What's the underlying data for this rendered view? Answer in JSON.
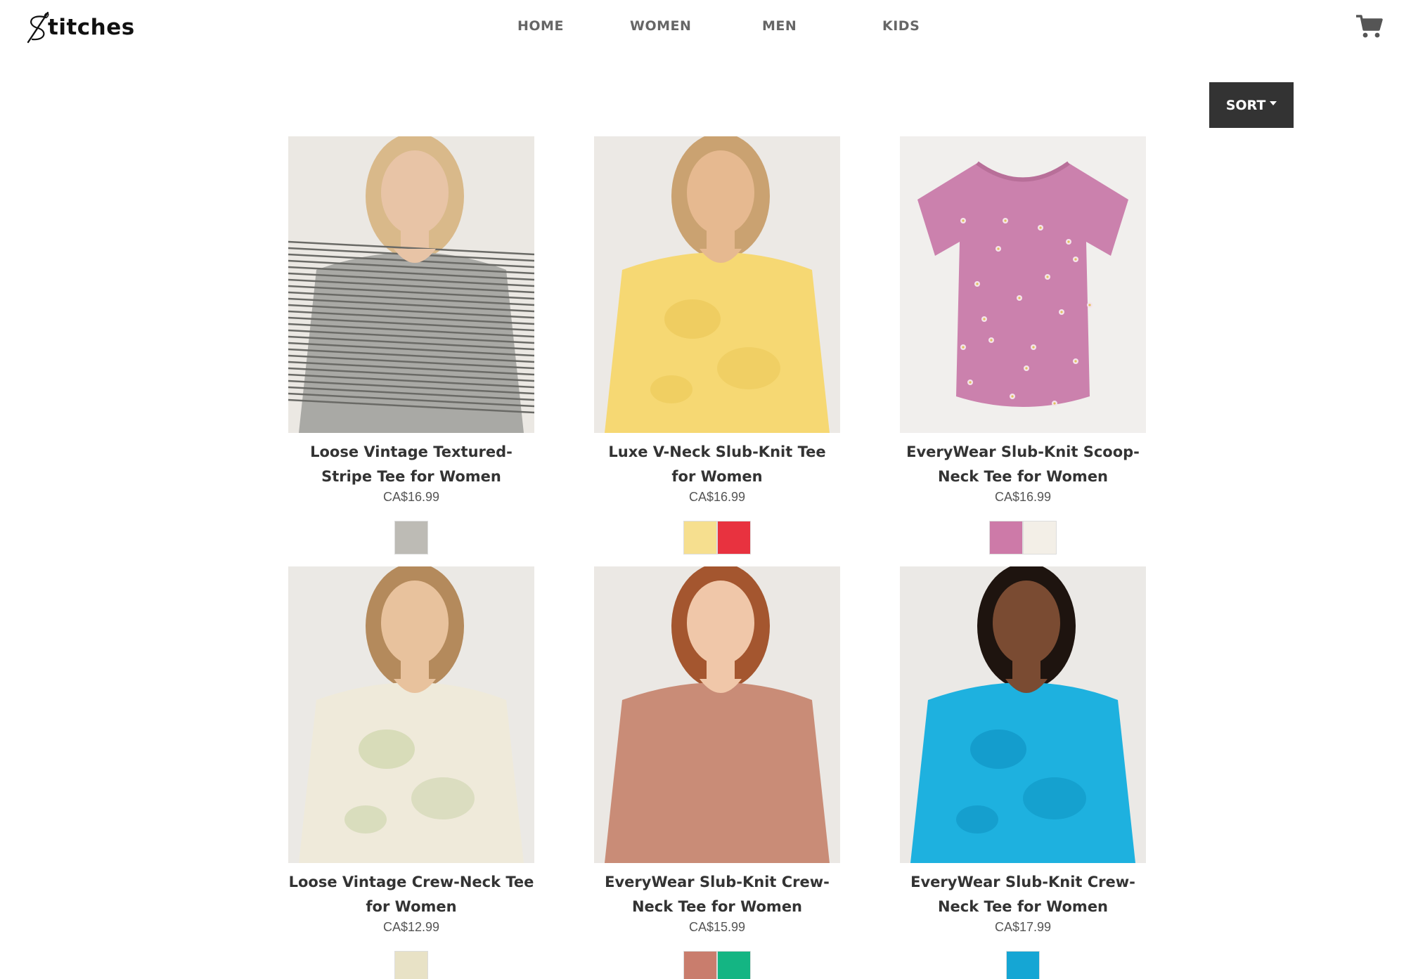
{
  "brand": {
    "name": "titches"
  },
  "nav": {
    "items": [
      "HOME",
      "WOMEN",
      "MEN",
      "KIDS"
    ]
  },
  "sort": {
    "label": "SORT"
  },
  "products": [
    {
      "title": "Loose Vintage Textured-Stripe Tee for Women",
      "price": "CA$16.99",
      "swatches": [
        "#bdbbb5"
      ],
      "image": "woman-striped-gray-tee",
      "colors": {
        "bg": "#ebe8e3",
        "shirt": "#a9a9a5",
        "stripe": "#6a6a66",
        "skin": "#e8c4a6",
        "hair": "#d9b98a"
      }
    },
    {
      "title": "Luxe V-Neck Slub-Knit Tee for Women",
      "price": "CA$16.99",
      "swatches": [
        "#f6df8f",
        "#e8323f"
      ],
      "image": "woman-yellow-vneck-tee",
      "colors": {
        "bg": "#ece9e5",
        "shirt": "#f6d873",
        "stripe": "#e9c552",
        "skin": "#e6b990",
        "hair": "#caa271"
      }
    },
    {
      "title": "EveryWear Slub-Knit Scoop-Neck Tee for Women",
      "price": "CA$16.99",
      "swatches": [
        "#cd7aa8",
        "#f3efe7"
      ],
      "image": "pink-floral-tee",
      "colors": {
        "bg": "#f1efed",
        "shirt": "#cb81ad",
        "stripe": "#f4e3ea",
        "skin": "#f1efed",
        "hair": "#f1efed"
      }
    },
    {
      "title": "Loose Vintage Crew-Neck Tee for Women",
      "price": "CA$12.99",
      "swatches": [
        "#e8e2c6"
      ],
      "image": "woman-tie-dye-tee",
      "colors": {
        "bg": "#ebe9e5",
        "shirt": "#efeada",
        "stripe": "#c4cf9f",
        "skin": "#e8c29d",
        "hair": "#b48a5c"
      }
    },
    {
      "title": "EveryWear Slub-Knit Crew-Neck Tee for Women",
      "price": "CA$15.99",
      "swatches": [
        "#c97d6d",
        "#14b583"
      ],
      "image": "woman-terracotta-tee",
      "colors": {
        "bg": "#ebe8e4",
        "shirt": "#c98c77",
        "stripe": "#b87b66",
        "skin": "#f0c7a9",
        "hair": "#a4562f"
      }
    },
    {
      "title": "EveryWear Slub-Knit Crew-Neck Tee for Women",
      "price": "CA$17.99",
      "swatches": [
        "#15a6d4"
      ],
      "image": "woman-blue-tie-dye-tee",
      "colors": {
        "bg": "#ebe9e6",
        "shirt": "#1eb1df",
        "stripe": "#0c8dbd",
        "skin": "#7a4b32",
        "hair": "#1e140f"
      }
    }
  ]
}
